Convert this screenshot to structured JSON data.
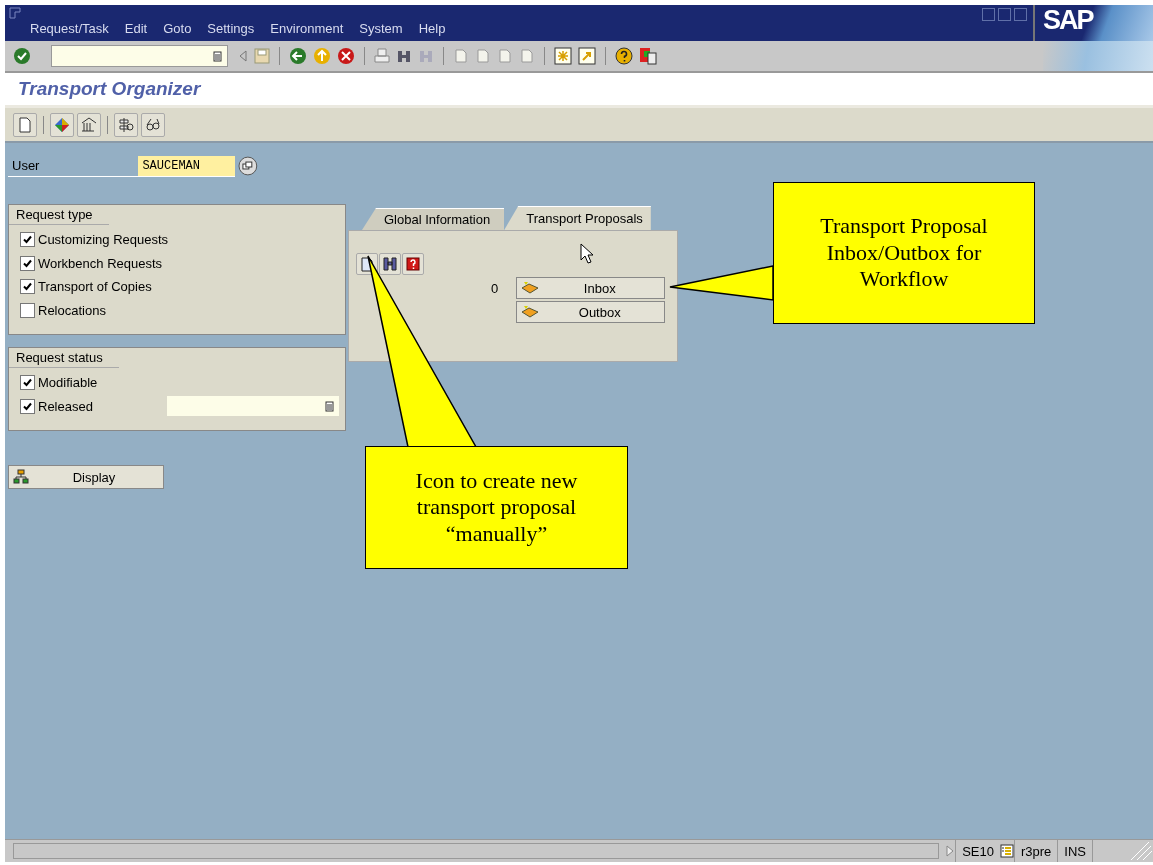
{
  "menu": [
    "Request/Task",
    "Edit",
    "Goto",
    "Settings",
    "Environment",
    "System",
    "Help"
  ],
  "logo": "SAP",
  "title": "Transport Organizer",
  "user": {
    "label": "User",
    "value": "SAUCEMAN"
  },
  "request_type": {
    "title": "Request type",
    "options": [
      {
        "label": "Customizing Requests",
        "checked": true
      },
      {
        "label": "Workbench Requests",
        "checked": true
      },
      {
        "label": "Transport of Copies",
        "checked": true
      },
      {
        "label": "Relocations",
        "checked": false
      }
    ]
  },
  "request_status": {
    "title": "Request status",
    "options": [
      {
        "label": "Modifiable",
        "checked": true
      },
      {
        "label": "Released",
        "checked": true
      }
    ]
  },
  "display_button": "Display",
  "tabs": [
    {
      "label": "Global Information",
      "selected": false
    },
    {
      "label": "Transport Proposals",
      "selected": true
    }
  ],
  "proposals": {
    "count": "0",
    "buttons": [
      "Inbox",
      "Outbox"
    ]
  },
  "callouts": [
    {
      "text": "Transport Proposal Inbox/Outbox for Workflow"
    },
    {
      "text": "Icon to create new transport proposal “manually”"
    }
  ],
  "status_bar": {
    "transaction": "SE10",
    "system": "r3pre",
    "mode": "INS"
  }
}
